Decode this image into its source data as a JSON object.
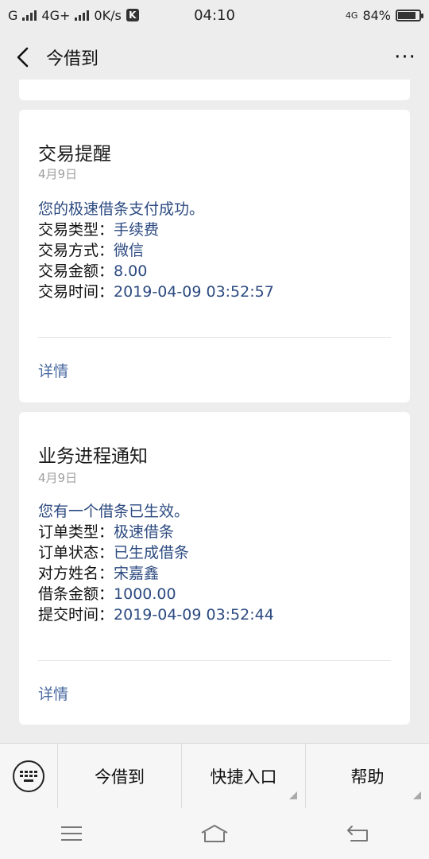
{
  "status_bar": {
    "carrier1": "G",
    "network": "4G+",
    "speed": "0K/s",
    "k_badge": "K",
    "time": "04:10",
    "net_right": "4G",
    "battery_text": "84%",
    "battery_level": 0.84
  },
  "nav": {
    "title": "今借到",
    "more": "···"
  },
  "cards": [
    {
      "title": "交易提醒",
      "date": "4月9日",
      "headline": "您的极速借条支付成功。",
      "fields": [
        {
          "label": "交易类型：",
          "value": "手续费"
        },
        {
          "label": "交易方式：",
          "value": "微信"
        },
        {
          "label": "交易金额：",
          "value": "8.00"
        },
        {
          "label": "交易时间：",
          "value": "2019-04-09 03:52:57"
        }
      ],
      "detail": "详情"
    },
    {
      "title": "业务进程通知",
      "date": "4月9日",
      "headline": "您有一个借条已生效。",
      "fields": [
        {
          "label": "订单类型：",
          "value": "极速借条"
        },
        {
          "label": "订单状态：",
          "value": "已生成借条"
        },
        {
          "label": "对方姓名：",
          "value": "宋嘉鑫"
        },
        {
          "label": "借条金额：",
          "value": "1000.00"
        },
        {
          "label": "提交时间：",
          "value": "2019-04-09 03:52:44"
        }
      ],
      "detail": "详情"
    }
  ],
  "menu": {
    "items": [
      "今借到",
      "快捷入口",
      "帮助"
    ]
  },
  "colors": {
    "background": "#ededed",
    "value_blue": "#2c4a80",
    "link_blue": "#4a6aa0"
  }
}
